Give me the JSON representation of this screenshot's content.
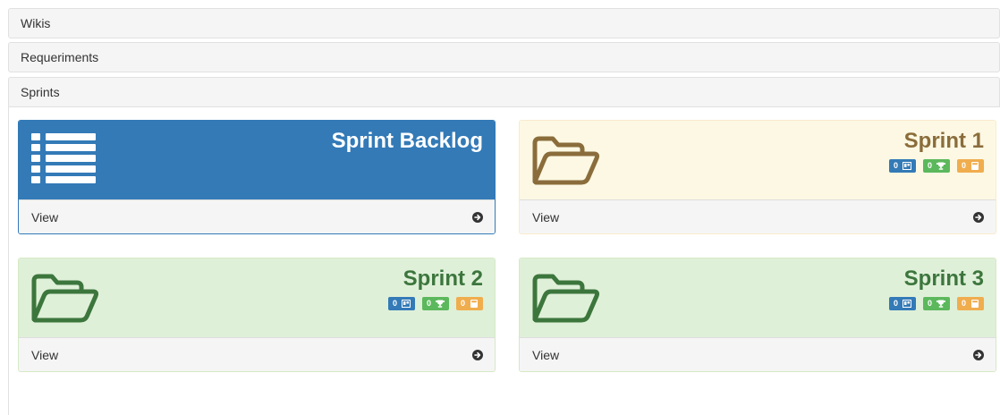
{
  "accordion": {
    "wikis": "Wikis",
    "requirements": "Requeriments",
    "sprints": "Sprints"
  },
  "colors": {
    "primary": "#337ab7",
    "warning_text": "#8a6d3b",
    "warning_bg": "#fcf8e3",
    "success_text": "#3c763d",
    "success_bg": "#dff0d8",
    "badge_green": "#5cb85c",
    "badge_orange": "#f0ad4e"
  },
  "cards": [
    {
      "title": "Sprint Backlog",
      "icon": "list-icon",
      "view_label": "View"
    },
    {
      "title": "Sprint 1",
      "icon": "folder-open-icon",
      "view_label": "View",
      "badges": [
        {
          "count": "0",
          "icon": "board-icon",
          "color": "blue"
        },
        {
          "count": "0",
          "icon": "trophy-icon",
          "color": "green"
        },
        {
          "count": "0",
          "icon": "calculator-icon",
          "color": "orange"
        }
      ]
    },
    {
      "title": "Sprint 2",
      "icon": "folder-open-icon",
      "view_label": "View",
      "badges": [
        {
          "count": "0",
          "icon": "board-icon",
          "color": "blue"
        },
        {
          "count": "0",
          "icon": "trophy-icon",
          "color": "green"
        },
        {
          "count": "0",
          "icon": "calculator-icon",
          "color": "orange"
        }
      ]
    },
    {
      "title": "Sprint 3",
      "icon": "folder-open-icon",
      "view_label": "View",
      "badges": [
        {
          "count": "0",
          "icon": "board-icon",
          "color": "blue"
        },
        {
          "count": "0",
          "icon": "trophy-icon",
          "color": "green"
        },
        {
          "count": "0",
          "icon": "calculator-icon",
          "color": "orange"
        }
      ]
    }
  ]
}
